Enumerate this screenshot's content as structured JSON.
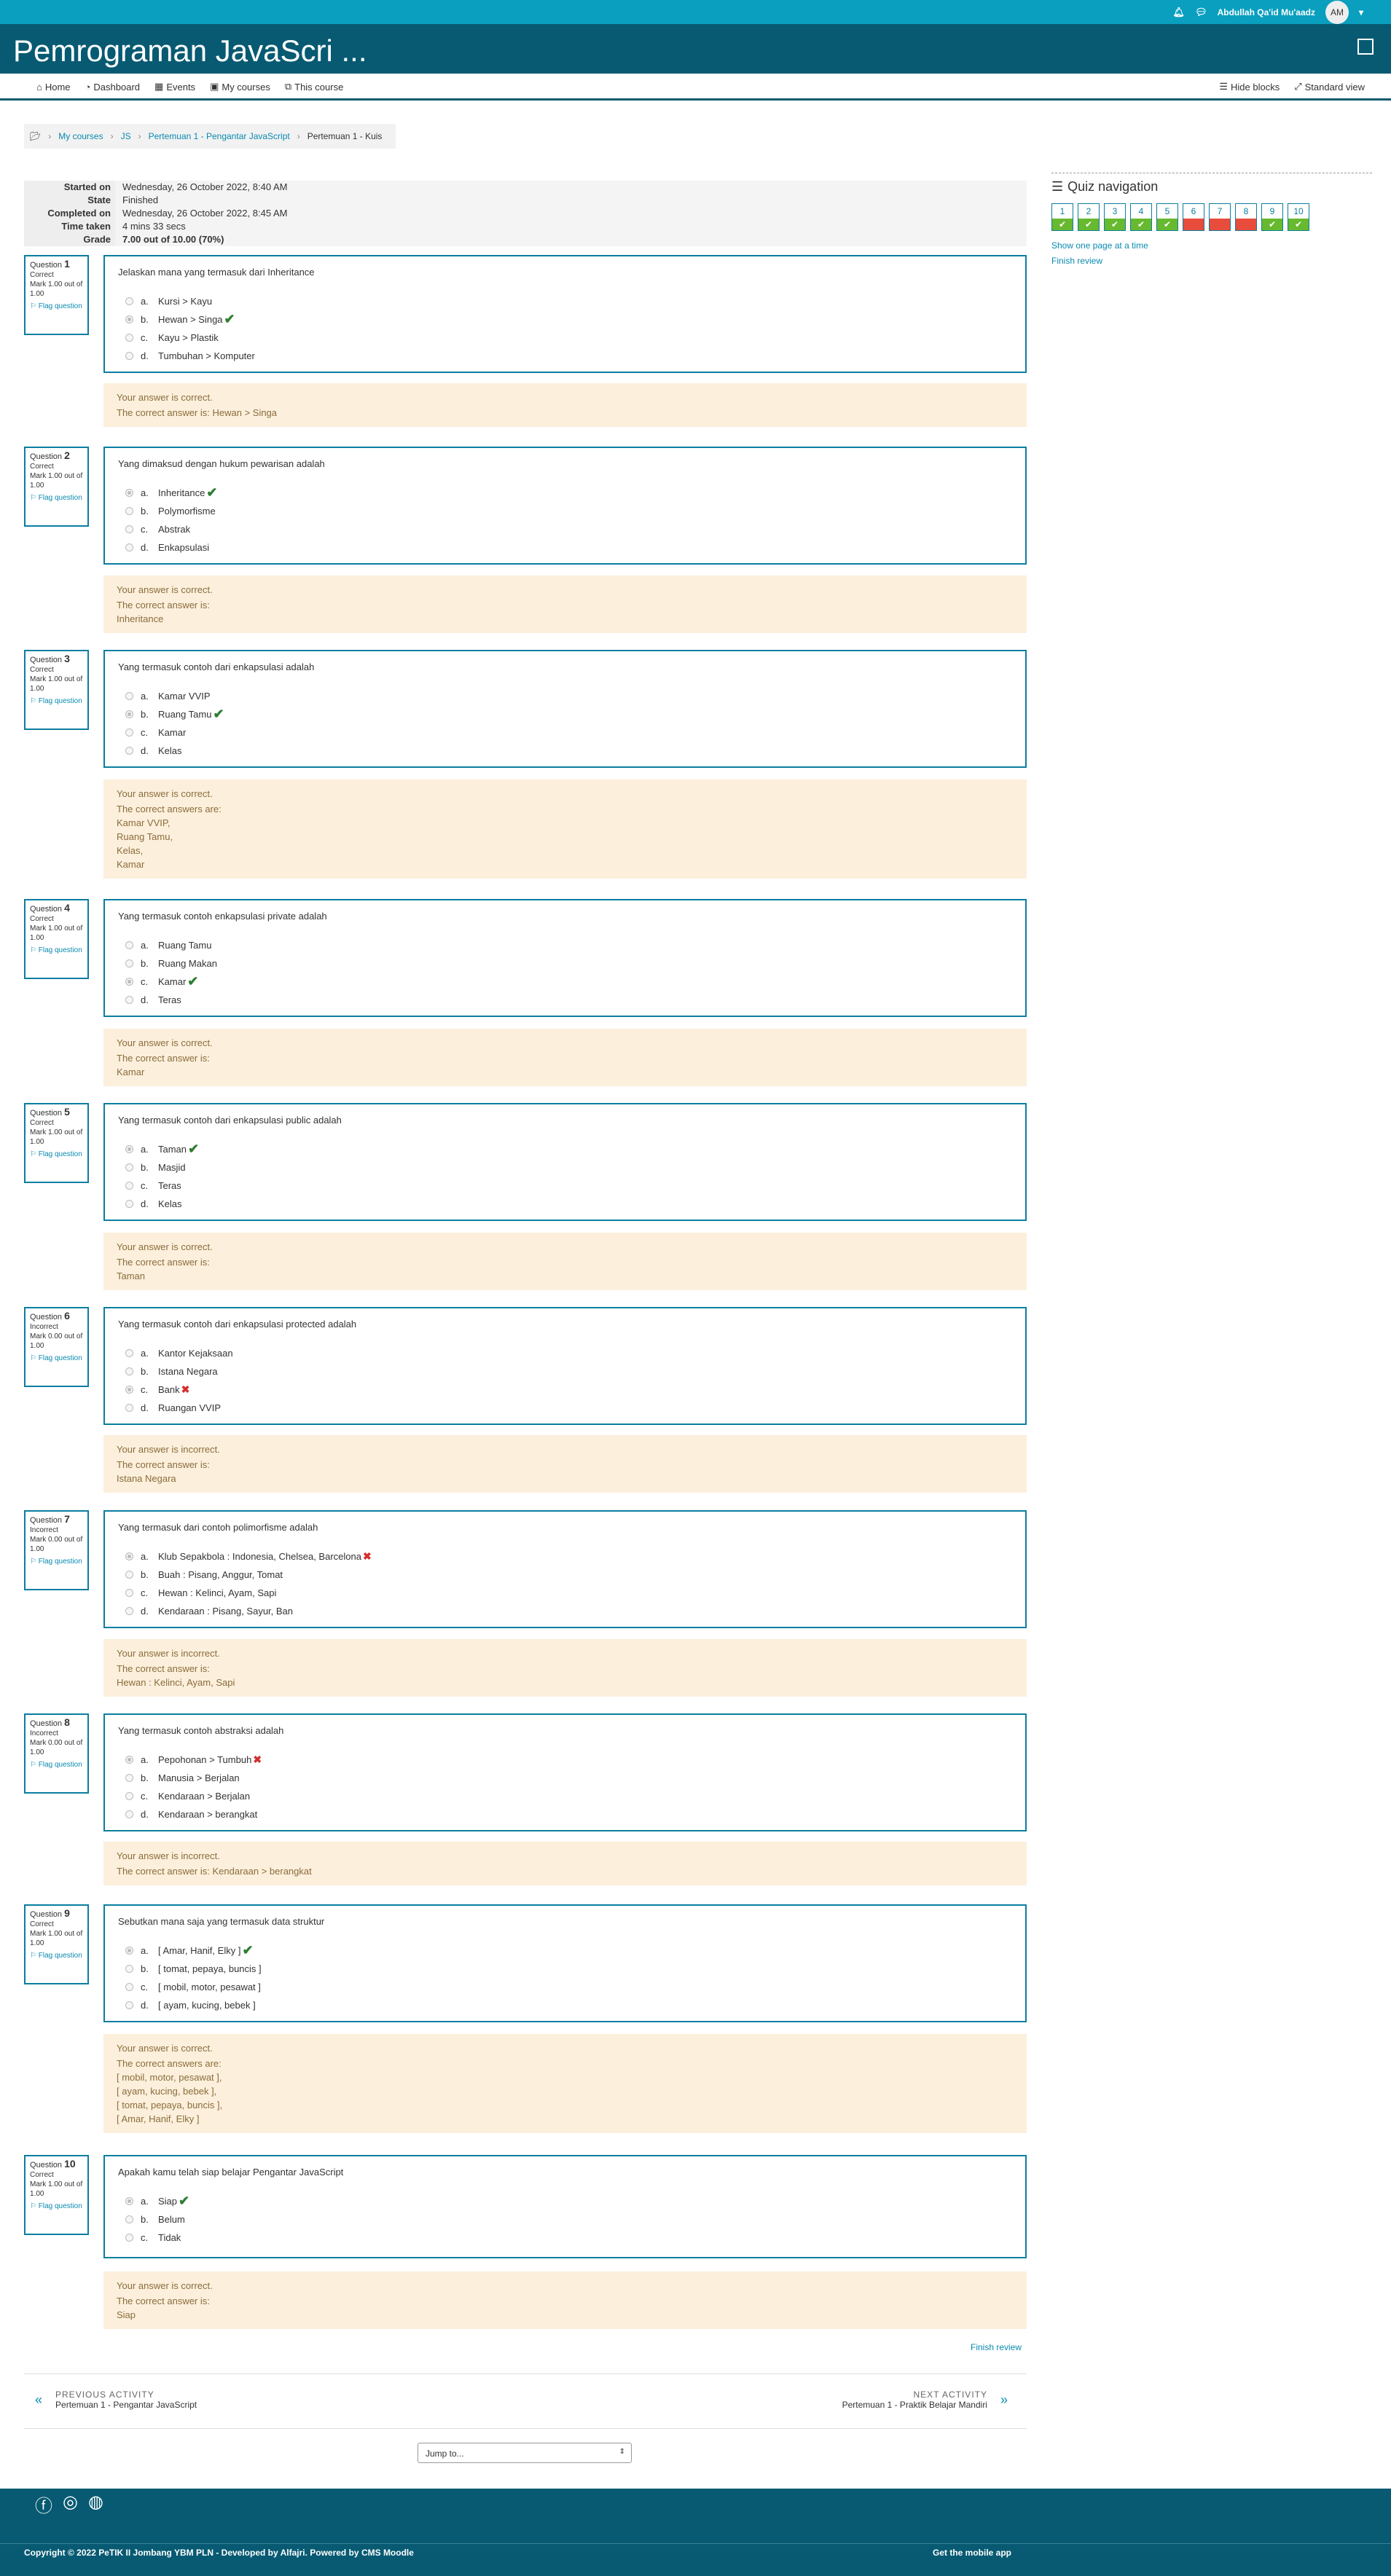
{
  "topbar": {
    "user_name": "Abdullah Qa'id Mu'aadz",
    "initials": "AM"
  },
  "header": {
    "title": "Pemrograman JavaScri ..."
  },
  "nav": {
    "home": "Home",
    "dashboard": "Dashboard",
    "events": "Events",
    "my_courses": "My courses",
    "this_course": "This course",
    "hide_blocks": "Hide blocks",
    "standard_view": "Standard view"
  },
  "breadcrumb": [
    "My courses",
    "JS",
    "Pertemuan 1 - Pengantar JavaScript",
    "Pertemuan 1 - Kuis"
  ],
  "summary": [
    {
      "k": "Started on",
      "v": "Wednesday, 26 October 2022, 8:40 AM"
    },
    {
      "k": "State",
      "v": "Finished"
    },
    {
      "k": "Completed on",
      "v": "Wednesday, 26 October 2022, 8:45 AM"
    },
    {
      "k": "Time taken",
      "v": "4 mins 33 secs"
    },
    {
      "k": "Grade",
      "v": "7.00 out of 10.00 (70%)"
    }
  ],
  "labels": {
    "question": "Question",
    "flag": "Flag question",
    "letters": [
      "a.",
      "b.",
      "c.",
      "d."
    ]
  },
  "questions": [
    {
      "n": "1",
      "state": "Correct",
      "mark": "Mark 1.00 out of 1.00",
      "text": "Jelaskan mana yang termasuk dari Inheritance",
      "options": [
        "Kursi > Kayu",
        "Hewan > Singa",
        "Kayu > Plastik",
        "Tumbuhan > Komputer"
      ],
      "sel": 1,
      "ok": true,
      "fb_state": "Your answer is correct.",
      "fb_lines": [
        "The correct answer is: Hewan > Singa"
      ]
    },
    {
      "n": "2",
      "state": "Correct",
      "mark": "Mark 1.00 out of 1.00",
      "text": "Yang dimaksud dengan hukum pewarisan adalah",
      "options": [
        "Inheritance",
        "Polymorfisme",
        "Abstrak",
        "Enkapsulasi"
      ],
      "sel": 0,
      "ok": true,
      "fb_state": "Your answer is correct.",
      "fb_lines": [
        "The correct answer is:",
        "Inheritance"
      ]
    },
    {
      "n": "3",
      "state": "Correct",
      "mark": "Mark 1.00 out of 1.00",
      "text": "Yang termasuk contoh dari enkapsulasi adalah",
      "options": [
        "Kamar VVIP",
        "Ruang Tamu",
        "Kamar",
        "Kelas"
      ],
      "sel": 1,
      "ok": true,
      "fb_state": "Your answer is correct.",
      "fb_lines": [
        "The correct answers are:",
        "Kamar VVIP,",
        "Ruang Tamu,",
        "Kelas,",
        "Kamar"
      ]
    },
    {
      "n": "4",
      "state": "Correct",
      "mark": "Mark 1.00 out of 1.00",
      "text": "Yang termasuk contoh enkapsulasi private adalah",
      "options": [
        "Ruang Tamu",
        "Ruang Makan",
        "Kamar",
        "Teras"
      ],
      "sel": 2,
      "ok": true,
      "fb_state": "Your answer is correct.",
      "fb_lines": [
        "The correct answer is:",
        "Kamar"
      ]
    },
    {
      "n": "5",
      "state": "Correct",
      "mark": "Mark 1.00 out of 1.00",
      "text": "Yang termasuk contoh dari enkapsulasi public adalah",
      "options": [
        "Taman",
        "Masjid",
        "Teras",
        "Kelas"
      ],
      "sel": 0,
      "ok": true,
      "fb_state": "Your answer is correct.",
      "fb_lines": [
        "The correct answer is:",
        "Taman"
      ]
    },
    {
      "n": "6",
      "state": "Incorrect",
      "mark": "Mark 0.00 out of 1.00",
      "text": "Yang termasuk contoh dari enkapsulasi protected adalah",
      "options": [
        "Kantor Kejaksaan",
        "Istana Negara",
        "Bank",
        "Ruangan VVIP"
      ],
      "sel": 2,
      "ok": false,
      "fb_state": "Your answer is incorrect.",
      "fb_lines": [
        "The correct answer is:",
        "Istana Negara"
      ]
    },
    {
      "n": "7",
      "state": "Incorrect",
      "mark": "Mark 0.00 out of 1.00",
      "text": "Yang termasuk dari contoh polimorfisme adalah",
      "options": [
        "Klub Sepakbola : Indonesia, Chelsea, Barcelona",
        "Buah : Pisang, Anggur, Tomat",
        "Hewan : Kelinci, Ayam, Sapi",
        "Kendaraan : Pisang, Sayur, Ban"
      ],
      "sel": 0,
      "ok": false,
      "fb_state": "Your answer is incorrect.",
      "fb_lines": [
        "The correct answer is:",
        "Hewan : Kelinci, Ayam, Sapi"
      ]
    },
    {
      "n": "8",
      "state": "Incorrect",
      "mark": "Mark 0.00 out of 1.00",
      "text": "Yang termasuk contoh abstraksi adalah",
      "options": [
        "Pepohonan > Tumbuh",
        "Manusia > Berjalan",
        "Kendaraan > Berjalan",
        "Kendaraan > berangkat"
      ],
      "sel": 0,
      "ok": false,
      "fb_state": "Your answer is incorrect.",
      "fb_lines": [
        "The correct answer is: Kendaraan > berangkat"
      ]
    },
    {
      "n": "9",
      "state": "Correct",
      "mark": "Mark 1.00 out of 1.00",
      "text": "Sebutkan mana saja yang termasuk data struktur",
      "options": [
        "[ Amar, Hanif, Elky ]",
        "[ tomat, pepaya, buncis ]",
        "[ mobil, motor, pesawat ]",
        "[ ayam, kucing, bebek ]"
      ],
      "sel": 0,
      "ok": true,
      "fb_state": "Your answer is correct.",
      "fb_lines": [
        "The correct answers are:",
        "[ mobil, motor, pesawat ],",
        "[ ayam, kucing, bebek ],",
        "[ tomat, pepaya, buncis ],",
        "[ Amar, Hanif, Elky ]"
      ]
    },
    {
      "n": "10",
      "state": "Correct",
      "mark": "Mark 1.00 out of 1.00",
      "text": "Apakah kamu telah siap belajar Pengantar JavaScript",
      "options": [
        "Siap",
        "Belum",
        "Tidak"
      ],
      "sel": 0,
      "ok": true,
      "fb_state": "Your answer is correct.",
      "fb_lines": [
        "The correct answer is:",
        "Siap"
      ]
    }
  ],
  "quiz_nav": {
    "title": "Quiz navigation",
    "show_one_page": "Show one page at a time",
    "finish_review": "Finish review",
    "items": [
      {
        "n": "1",
        "s": "correct"
      },
      {
        "n": "2",
        "s": "correct"
      },
      {
        "n": "3",
        "s": "correct"
      },
      {
        "n": "4",
        "s": "correct"
      },
      {
        "n": "5",
        "s": "correct"
      },
      {
        "n": "6",
        "s": "incorrect"
      },
      {
        "n": "7",
        "s": "incorrect"
      },
      {
        "n": "8",
        "s": "incorrect"
      },
      {
        "n": "9",
        "s": "correct"
      },
      {
        "n": "10",
        "s": "correct"
      }
    ]
  },
  "finish_review": "Finish review",
  "prev": {
    "label": "PREVIOUS ACTIVITY",
    "name": "Pertemuan 1 - Pengantar JavaScript"
  },
  "next": {
    "label": "NEXT ACTIVITY",
    "name": "Pertemuan 1 - Praktik Belajar Mandiri"
  },
  "jump": "Jump to...",
  "footer": {
    "copyright": "Copyright © 2022 PeTIK II Jombang YBM PLN - Developed by Alfajri. Powered by CMS Moodle",
    "mobile": "Get the mobile app"
  }
}
